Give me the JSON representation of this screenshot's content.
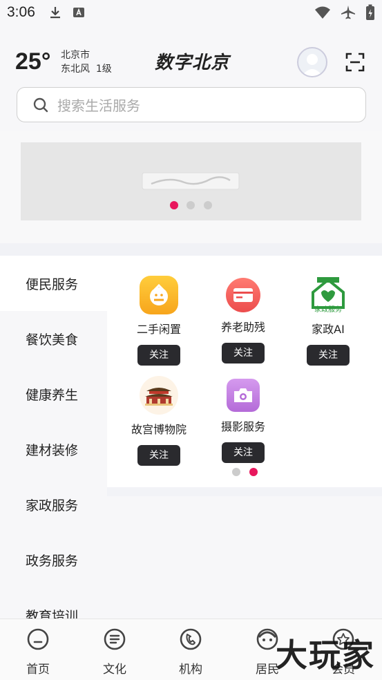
{
  "status_bar": {
    "time": "3:06"
  },
  "header": {
    "temperature": "25°",
    "city": "北京市",
    "weather": "东北风  1级",
    "app_title": "数字北京"
  },
  "search": {
    "placeholder": "搜索生活服务"
  },
  "banner": {
    "dot_count": 3,
    "active_dot": 0
  },
  "categories": [
    {
      "label": "便民服务",
      "active": true
    },
    {
      "label": "餐饮美食",
      "active": false
    },
    {
      "label": "健康养生",
      "active": false
    },
    {
      "label": "建材装修",
      "active": false
    },
    {
      "label": "家政服务",
      "active": false
    },
    {
      "label": "政务服务",
      "active": false
    },
    {
      "label": "教育培训",
      "active": false
    }
  ],
  "services": [
    {
      "name": "二手闲置",
      "follow_label": "关注",
      "icon": "secondhand-icon"
    },
    {
      "name": "养老助残",
      "follow_label": "关注",
      "icon": "elderly-care-icon"
    },
    {
      "name": "家政AI",
      "follow_label": "关注",
      "icon": "housekeeping-icon"
    },
    {
      "name": "故宫博物院",
      "follow_label": "关注",
      "icon": "palace-museum-icon"
    },
    {
      "name": "摄影服务",
      "follow_label": "关注",
      "icon": "camera-icon"
    }
  ],
  "service_pager": {
    "dot_count": 2,
    "active_dot": 1
  },
  "bottom_nav": [
    {
      "label": "首页",
      "icon": "home-icon"
    },
    {
      "label": "文化",
      "icon": "culture-icon"
    },
    {
      "label": "机构",
      "icon": "organization-icon"
    },
    {
      "label": "居民",
      "icon": "resident-icon"
    },
    {
      "label": "会员",
      "icon": "member-icon"
    }
  ],
  "watermark": "大玩家",
  "colors": {
    "accent_pink": "#e8175d",
    "dot_inactive": "#cccccc",
    "follow_bg": "#2a2a2e"
  }
}
